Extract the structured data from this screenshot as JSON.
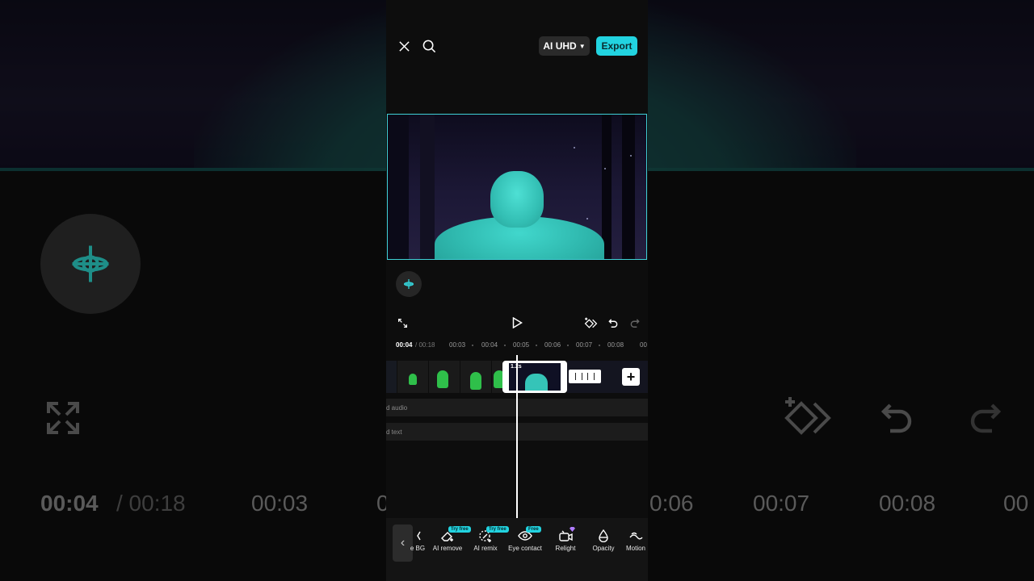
{
  "topbar": {
    "close_icon": "close-icon",
    "search_icon": "search-icon",
    "quality_label": "AI UHD",
    "export_label": "Export",
    "accent_color": "#22d3e0"
  },
  "timeline": {
    "current_time": "00:04",
    "total_time": "/ 00:18",
    "ticks": [
      "00:03",
      "00:04",
      "00:05",
      "00:06",
      "00:07",
      "00:08",
      "00"
    ],
    "selected_clip_duration": "1.2s",
    "audio_track_label": "d audio",
    "text_track_label": "d text"
  },
  "toolbar": {
    "items": [
      {
        "label": "e BG",
        "icon": "remove-bg-icon",
        "badge": ""
      },
      {
        "label": "AI remove",
        "icon": "eraser-icon",
        "badge": "Try free"
      },
      {
        "label": "AI remix",
        "icon": "sparkle-brush-icon",
        "badge": "Try free"
      },
      {
        "label": "Eye contact",
        "icon": "eye-icon",
        "badge": "Free"
      },
      {
        "label": "Relight",
        "icon": "relight-icon",
        "badge": ""
      },
      {
        "label": "Opacity",
        "icon": "drop-icon",
        "badge": ""
      },
      {
        "label": "Motion",
        "icon": "motion-icon",
        "badge": ""
      }
    ]
  },
  "background_echo": {
    "current_time": "00:04",
    "total_time": "/ 00:18",
    "ticks": [
      "00:03",
      "0",
      "0:06",
      "00:07",
      "00:08",
      "00"
    ]
  }
}
